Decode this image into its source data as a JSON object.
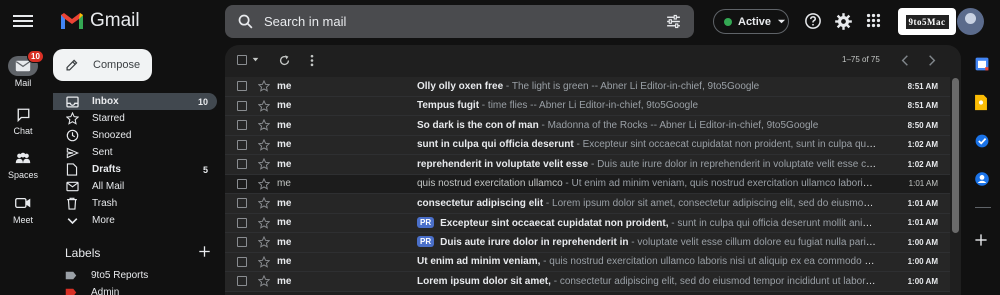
{
  "header": {
    "app_name": "Gmail",
    "search_placeholder": "Search in mail",
    "status_label": "Active",
    "profile_logo_text": "9to5Mac"
  },
  "rail": {
    "items": [
      {
        "label": "Mail",
        "icon": "mail-icon",
        "badge": "10",
        "active": true
      },
      {
        "label": "Chat",
        "icon": "chat-icon"
      },
      {
        "label": "Spaces",
        "icon": "spaces-icon"
      },
      {
        "label": "Meet",
        "icon": "meet-icon"
      }
    ]
  },
  "compose": {
    "label": "Compose"
  },
  "folders": [
    {
      "label": "Inbox",
      "icon": "inbox-icon",
      "count": "10",
      "bold": true,
      "active": true
    },
    {
      "label": "Starred",
      "icon": "star-icon",
      "count": ""
    },
    {
      "label": "Snoozed",
      "icon": "clock-icon",
      "count": ""
    },
    {
      "label": "Sent",
      "icon": "send-icon",
      "count": ""
    },
    {
      "label": "Drafts",
      "icon": "draft-icon",
      "count": "5",
      "bold": true
    },
    {
      "label": "All Mail",
      "icon": "all-mail-icon",
      "count": ""
    },
    {
      "label": "Trash",
      "icon": "trash-icon",
      "count": ""
    },
    {
      "label": "More",
      "icon": "chevron-down-icon",
      "count": ""
    }
  ],
  "labels": {
    "heading": "Labels",
    "items": [
      {
        "label": "9to5 Reports",
        "color": "#9aa0a6"
      },
      {
        "label": "Admin",
        "color": "#d93025"
      }
    ]
  },
  "pager": {
    "text": "1–75 of 75"
  },
  "emails": [
    {
      "sender": "me",
      "subject": "Olly olly oxen free",
      "snippet": "The light is green -- Abner Li Editor-in-chief, 9to5Google",
      "time": "8:51 AM",
      "unread": true,
      "tag": ""
    },
    {
      "sender": "me",
      "subject": "Tempus fugit",
      "snippet": "time flies -- Abner Li Editor-in-chief, 9to5Google",
      "time": "8:51 AM",
      "unread": true,
      "tag": ""
    },
    {
      "sender": "me",
      "subject": "So dark is the con of man",
      "snippet": "Madonna of the Rocks -- Abner Li Editor-in-chief, 9to5Google",
      "time": "8:50 AM",
      "unread": true,
      "tag": ""
    },
    {
      "sender": "me",
      "subject": "sunt in culpa qui officia deserunt",
      "snippet": "Excepteur sint occaecat cupidatat non proident, sunt in culpa qui officia deserunt mollit anim id est laborum",
      "time": "1:02 AM",
      "unread": true,
      "tag": ""
    },
    {
      "sender": "me",
      "subject": "reprehenderit in voluptate velit esse",
      "snippet": "Duis aute irure dolor in reprehenderit in voluptate velit esse cillum dolore eu fugiat nulla pariatur",
      "time": "1:02 AM",
      "unread": true,
      "tag": ""
    },
    {
      "sender": "me",
      "subject": "quis nostrud exercitation ullamco",
      "snippet": "Ut enim ad minim veniam, quis nostrud exercitation ullamco laboris nisi ut aliquip",
      "time": "1:01 AM",
      "unread": false,
      "tag": ""
    },
    {
      "sender": "me",
      "subject": "consectetur adipiscing elit",
      "snippet": "Lorem ipsum dolor sit amet, consectetur adipiscing elit, sed do eiusmod tempor incididunt",
      "time": "1:01 AM",
      "unread": true,
      "tag": ""
    },
    {
      "sender": "me",
      "subject": "Excepteur sint occaecat cupidatat non proident,",
      "snippet": "sunt in culpa qui officia deserunt mollit anim id est laborum",
      "time": "1:01 AM",
      "unread": true,
      "tag": "PR"
    },
    {
      "sender": "me",
      "subject": "Duis aute irure dolor in reprehenderit in",
      "snippet": "voluptate velit esse cillum dolore eu fugiat nulla pariatur",
      "time": "1:00 AM",
      "unread": true,
      "tag": "PR"
    },
    {
      "sender": "me",
      "subject": "Ut enim ad minim veniam,",
      "snippet": "quis nostrud exercitation ullamco laboris nisi ut aliquip ex ea commodo consequat",
      "time": "1:00 AM",
      "unread": true,
      "tag": ""
    },
    {
      "sender": "me",
      "subject": "Lorem ipsum dolor sit amet,",
      "snippet": "consectetur adipiscing elit, sed do eiusmod tempor incididunt ut labore et dolore",
      "time": "1:00 AM",
      "unread": true,
      "tag": ""
    }
  ],
  "colors": {
    "accent": "#4a6fc9",
    "badge": "#d93025",
    "active_dot": "#34a853"
  }
}
